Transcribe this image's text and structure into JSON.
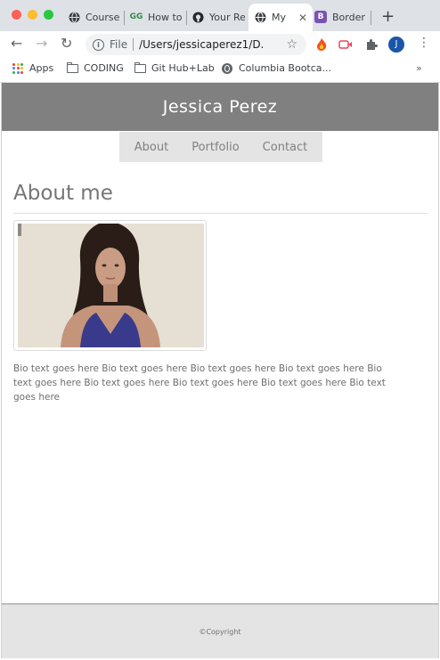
{
  "browser": {
    "tabs": [
      {
        "label": "Course",
        "icon": "globe-icon"
      },
      {
        "label": "How to",
        "icon": "geeksforgeeks-icon"
      },
      {
        "label": "Your Re",
        "icon": "github-icon"
      },
      {
        "label": "My",
        "icon": "globe-icon",
        "active": true
      },
      {
        "label": "Border",
        "icon": "bootstrap-icon"
      }
    ],
    "new_tab": "+",
    "omnibox": {
      "scheme": "File",
      "url": "/Users/jessicaperez1/D..."
    },
    "profile_initial": "J",
    "bookmarks": [
      {
        "label": "Apps",
        "icon": "apps-grid-icon"
      },
      {
        "label": "CODING",
        "icon": "folder-icon"
      },
      {
        "label": "Git Hub+Lab",
        "icon": "folder-icon"
      },
      {
        "label": "Columbia Bootca...",
        "icon": "globe-icon"
      }
    ],
    "more_bookmarks": "»"
  },
  "site": {
    "title": "Jessica Perez",
    "nav": [
      "About",
      "Portfolio",
      "Contact"
    ],
    "section_heading": "About me",
    "bio": "Bio text goes here Bio text goes here Bio text goes here Bio text goes here Bio text goes here Bio text goes here Bio text goes here Bio text goes here Bio text goes here",
    "footer": "©Copyright"
  },
  "colors": {
    "header_bg": "#808080",
    "nav_bg": "#e4e4e4",
    "footer_bg": "#e4e4e4",
    "text_gray": "#757575"
  }
}
